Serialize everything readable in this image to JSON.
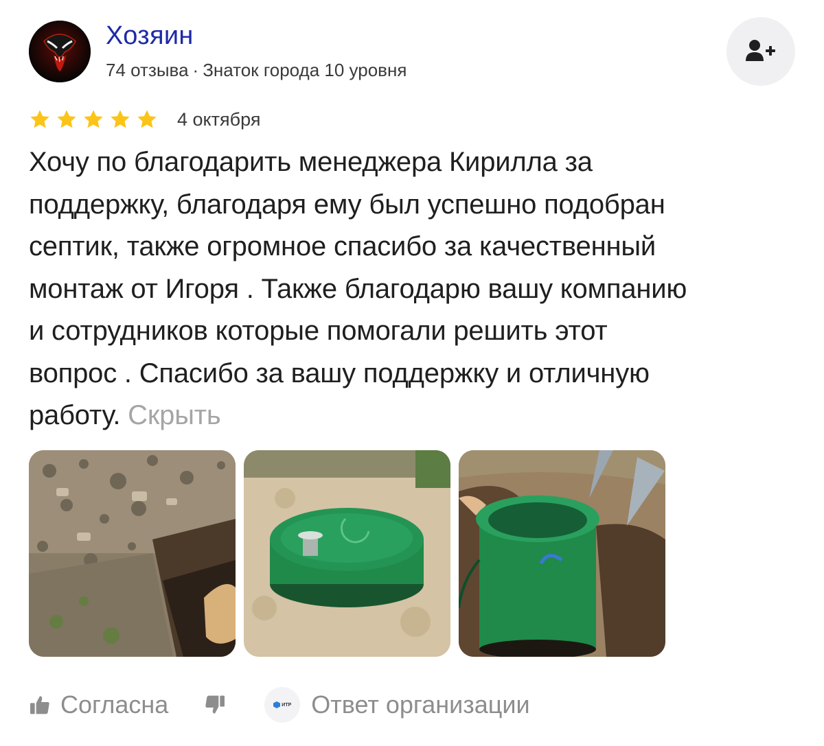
{
  "author": {
    "name": "Хозяин",
    "reviews_count": "74 отзыва",
    "separator": "·",
    "level": "Знаток города 10 уровня"
  },
  "subscribe": {
    "icon": "add-user-icon"
  },
  "review": {
    "rating": 5,
    "rating_max": 5,
    "star_color": "#fcc419",
    "date": "4 октября",
    "text_lines": [
      "Хочу по благодарить менеджера Кирилла за",
      "поддержку, благодаря ему был успешно подобран",
      "септик, также огромное спасибо за качественный",
      "монтаж от Игоря . Также благодарю вашу компанию",
      "и сотрудников которые помогали решить этот",
      "вопрос . Спасибо за вашу поддержку и отличную",
      "работу."
    ],
    "hide_label": "Скрыть"
  },
  "photos": [
    {
      "name": "photo-trench"
    },
    {
      "name": "photo-septic-lid"
    },
    {
      "name": "photo-septic-pit"
    }
  ],
  "actions": {
    "like_label": "Согласна",
    "like_icon": "thumbs-up-icon",
    "dislike_icon": "thumbs-down-icon",
    "org_logo_text": "ИТР",
    "org_reply_label": "Ответ организации"
  },
  "colors": {
    "author_name": "#1d2aa8",
    "muted": "#8d8d8d",
    "hide_link": "#a5a5a5",
    "septic_green": "#1f8a4a"
  }
}
